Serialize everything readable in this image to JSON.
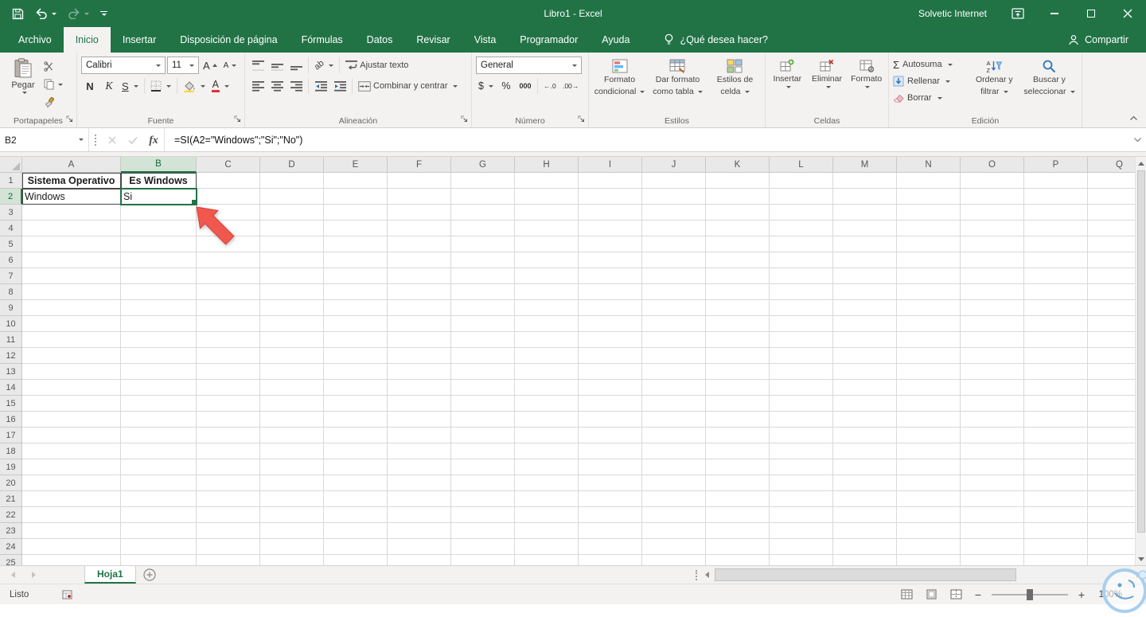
{
  "titlebar": {
    "title": "Libro1  -  Excel",
    "account": "Solvetic Internet"
  },
  "menu": {
    "tabs": [
      {
        "label": "Archivo",
        "active": false
      },
      {
        "label": "Inicio",
        "active": true
      },
      {
        "label": "Insertar",
        "active": false
      },
      {
        "label": "Disposición de página",
        "active": false
      },
      {
        "label": "Fórmulas",
        "active": false
      },
      {
        "label": "Datos",
        "active": false
      },
      {
        "label": "Revisar",
        "active": false
      },
      {
        "label": "Vista",
        "active": false
      },
      {
        "label": "Programador",
        "active": false
      },
      {
        "label": "Ayuda",
        "active": false
      }
    ],
    "tell_me": "¿Qué desea hacer?",
    "share": "Compartir"
  },
  "ribbon": {
    "clipboard": {
      "label": "Portapapeles",
      "paste": "Pegar"
    },
    "font": {
      "label": "Fuente",
      "family": "Calibri",
      "size": "11"
    },
    "alignment": {
      "label": "Alineación",
      "wrap_text": "Ajustar texto",
      "merge_center": "Combinar y centrar"
    },
    "number": {
      "label": "Número",
      "format": "General"
    },
    "styles": {
      "label": "Estilos",
      "conditional": [
        "Formato",
        "condicional"
      ],
      "format_table": [
        "Dar formato",
        "como tabla"
      ],
      "cell_styles": [
        "Estilos de",
        "celda"
      ]
    },
    "cells": {
      "label": "Celdas",
      "insert": "Insertar",
      "delete": "Eliminar",
      "format": "Formato"
    },
    "editing": {
      "label": "Edición",
      "autosum": "Autosuma",
      "fill": "Rellenar",
      "clear": "Borrar",
      "sort": [
        "Ordenar y",
        "filtrar"
      ],
      "find": [
        "Buscar y",
        "seleccionar"
      ]
    }
  },
  "icons": {
    "bold": "N",
    "italic": "K",
    "underline": "S",
    "grow_font": "A",
    "shrink_font": "A",
    "font_color": "A",
    "orientation": "ab",
    "autosum": "Σ",
    "currency": "$",
    "percent": "%",
    "thousands": "000",
    "increase_decimal": "←.0",
    "decrease_decimal": ".00→",
    "fx": "fx",
    "zoom_out": "−",
    "zoom_in": "+"
  },
  "formula_bar": {
    "name_box": "B2",
    "formula": "=SI(A2=\"Windows\";\"Si\";\"No\")"
  },
  "grid": {
    "columns": [
      "A",
      "B",
      "C",
      "D",
      "E",
      "F",
      "G",
      "H",
      "I",
      "J",
      "K",
      "L",
      "M",
      "N",
      "O",
      "P",
      "Q"
    ],
    "row_count": 24,
    "selected_cell": "B2",
    "selected_column": "B",
    "selected_row": 2,
    "cells": [
      {
        "ref": "A1",
        "text": "Sistema Operativo",
        "bold": true,
        "bordered": true,
        "align": "center"
      },
      {
        "ref": "B1",
        "text": "Es Windows",
        "bold": true,
        "bordered": true,
        "align": "center"
      },
      {
        "ref": "A2",
        "text": "Windows",
        "bold": false,
        "bordered": true,
        "align": "left"
      },
      {
        "ref": "B2",
        "text": "Si",
        "bold": false,
        "bordered": true,
        "align": "left"
      }
    ]
  },
  "sheets": {
    "tabs": [
      {
        "name": "Hoja1",
        "active": true
      }
    ]
  },
  "status_bar": {
    "mode": "Listo",
    "zoom": "100%"
  }
}
